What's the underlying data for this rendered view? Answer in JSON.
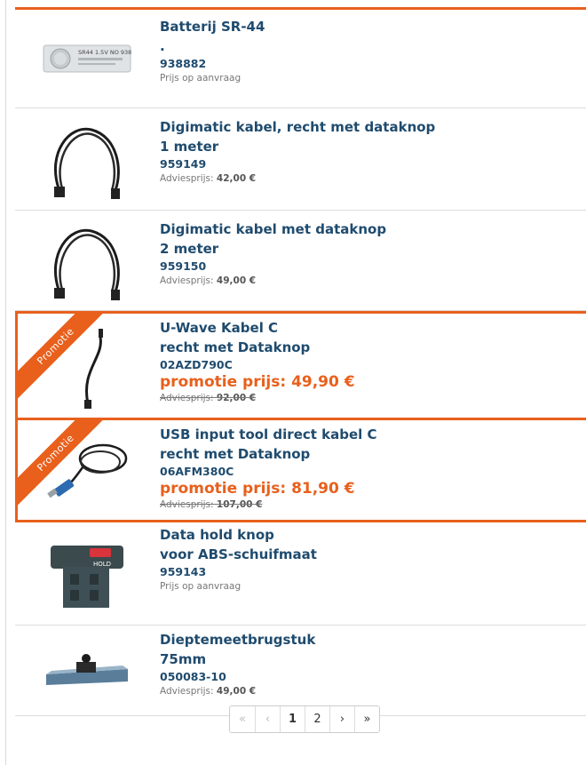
{
  "products": [
    {
      "title1": "Batterij SR-44",
      "title2": ".",
      "code": "938882",
      "price_text": "Prijs op aanvraag",
      "image": "battery-image",
      "image_text": "SR44 1.5V NO 938882 Mitutoyo"
    },
    {
      "title1": "Digimatic kabel, recht met dataknop",
      "title2": "1 meter",
      "code": "959149",
      "price_label": "Adviesprijs:",
      "price_value": "42,00 €",
      "image": "cable-image"
    },
    {
      "title1": "Digimatic kabel met dataknop",
      "title2": "2 meter",
      "code": "959150",
      "price_label": "Adviesprijs:",
      "price_value": "49,00 €",
      "image": "cable-image"
    },
    {
      "title1": "U-Wave Kabel C",
      "title2": "recht met Dataknop",
      "code": "02AZD790C",
      "promo_price": "promotie prijs: 49,90 €",
      "old_label": "Adviesprijs:",
      "old_value": "92,00 €",
      "badge": "Promotie",
      "image": "short-cable-image"
    },
    {
      "title1": "USB input tool direct kabel C",
      "title2": "recht met Dataknop",
      "code": "06AFM380C",
      "promo_price": "promotie prijs: 81,90 €",
      "old_label": "Adviesprijs:",
      "old_value": "107,00 €",
      "badge": "Promotie",
      "image": "usb-cable-image"
    },
    {
      "title1": "Data hold knop",
      "title2": "voor ABS-schuifmaat",
      "code": "959143",
      "price_text": "Prijs op aanvraag",
      "image": "hold-button-image",
      "image_text": "HOLD"
    },
    {
      "title1": "Dieptemeetbrugstuk",
      "title2": "75mm",
      "code": "050083-10",
      "price_label": "Adviesprijs:",
      "price_value": "49,00 €",
      "image": "depth-base-image"
    }
  ],
  "pagination": {
    "first": "«",
    "prev": "‹",
    "pages": [
      "1",
      "2"
    ],
    "current": "1",
    "next": "›",
    "last": "»"
  },
  "colors": {
    "accent": "#e8601c",
    "title": "#1f4b6e",
    "text_muted": "#777777"
  }
}
